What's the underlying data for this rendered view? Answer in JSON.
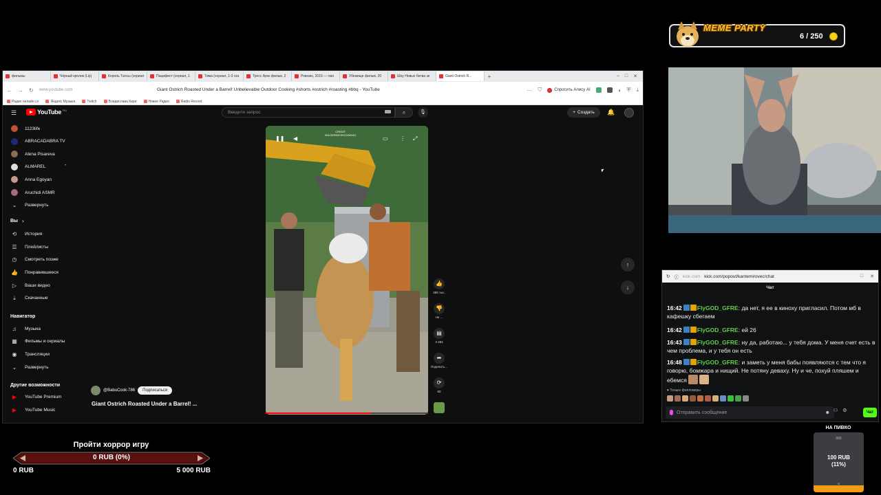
{
  "browser": {
    "tabs": [
      {
        "label": "фильмы"
      },
      {
        "label": "Чёрный кролик (Lip)"
      },
      {
        "label": "Король Талсы (сериал"
      },
      {
        "label": "Пацифист (сериал, 1"
      },
      {
        "label": "Тима (сериал, 1-3 сез"
      },
      {
        "label": "Тросс Архк фильм, 2"
      },
      {
        "label": "Ровнию, 2015 — смо"
      },
      {
        "label": "Убежище фильм, 20"
      },
      {
        "label": "Шоу Новых битва эк"
      },
      {
        "label": "Giant Ostrich R..."
      }
    ],
    "url_host": "www.youtube.com",
    "page_title": "Giant Ostrich Roasted Under a Barrel! Unbelievable Outdoor Cooking #shorts #ostrich #roasting #bbq - YouTube",
    "alice_label": "Спросить Алису AI",
    "bookmarks": [
      {
        "label": "Радио онлайн сл"
      },
      {
        "label": "Яндекс Музыка"
      },
      {
        "label": "Twitch"
      },
      {
        "label": "Владислава Кири"
      },
      {
        "label": "Новое Радио"
      },
      {
        "label": "Radio Record"
      }
    ]
  },
  "youtube": {
    "logo_text": "YouTube",
    "logo_region": "RU",
    "search_placeholder": "Введите запрос",
    "create_label": "Создать",
    "subscriptions": [
      {
        "label": "1123life",
        "color": "#b9563a"
      },
      {
        "label": "ABRACADABRA TV",
        "color": "#1c2b7a"
      },
      {
        "label": "Alena Pisareva",
        "color": "#8a6a58"
      },
      {
        "label": "ALMAREL",
        "color": "#ddd"
      },
      {
        "label": "Anna Egoyan",
        "color": "#c49a8a"
      },
      {
        "label": "Aruchidi ASMR",
        "color": "#a46b7b"
      }
    ],
    "expand_label": "Развернуть",
    "you_heading": "Вы",
    "you_items": [
      {
        "label": "История",
        "icon": "history-icon",
        "glyph": "⟲"
      },
      {
        "label": "Плейлисты",
        "icon": "playlist-icon",
        "glyph": "☰"
      },
      {
        "label": "Смотреть позже",
        "icon": "clock-icon",
        "glyph": "◷"
      },
      {
        "label": "Понравившиеся",
        "icon": "like-icon",
        "glyph": "👍"
      },
      {
        "label": "Ваши видео",
        "icon": "video-icon",
        "glyph": "▷"
      },
      {
        "label": "Скачанные",
        "icon": "download-icon",
        "glyph": "⤓"
      }
    ],
    "navigator_heading": "Навигатор",
    "navigator_items": [
      {
        "label": "Музыка",
        "icon": "music-icon",
        "glyph": "♫"
      },
      {
        "label": "Фильмы и сериалы",
        "icon": "film-icon",
        "glyph": "▦"
      },
      {
        "label": "Трансляции",
        "icon": "live-icon",
        "glyph": "◉"
      },
      {
        "label": "Развернуть",
        "icon": "chevron-down-icon",
        "glyph": "⌄"
      }
    ],
    "more_heading": "Другие возможности",
    "more_items": [
      {
        "label": "YouTube Premium",
        "icon": "premium-icon"
      },
      {
        "label": "YouTube Music",
        "icon": "yt-music-icon"
      }
    ],
    "short": {
      "credit": "CREDIT\nWILDERNESSCOOKING",
      "like_count": "386 тыс.",
      "dislike_label": "Не ...",
      "comment_count": "3 284",
      "share_label": "Поделить...",
      "remix_count": "60",
      "channel": "@BabuCook-786",
      "subscribe_label": "Подписаться",
      "title": "Giant Ostrich Roasted Under a Barrel! ...",
      "progress": 0.65
    }
  },
  "meme_party": {
    "title": "MEME PARTY",
    "count": "6 / 250"
  },
  "chat": {
    "url_host": "kick.com",
    "url_path": "kick.com/popout/kantemirovec/chat",
    "heading": "Чат",
    "messages": [
      {
        "time": "16:42",
        "user": "FlyGOD_GFRE",
        "text": "да нет, я ее в киноху пригласил. Потом мб в кафешку сбегаем"
      },
      {
        "time": "16:42",
        "user": "FlyGOD_GFRE",
        "text": "ей 26"
      },
      {
        "time": "16:43",
        "user": "FlyGOD_GFRE",
        "text": "ну да, работаю... у тебя дома. У меня счет есть в чем проблема, и у тебя он есть"
      },
      {
        "time": "16:48",
        "user": "FlyGOD_GFRE",
        "text": "и заметь у меня бабы появляются с тем что я говорю, бомжара и нищий. Не потяну деваху. Ну и че, похуй пляшем и ебемся"
      }
    ],
    "followers_only": "Только фолловеры",
    "input_placeholder": "Отправить сообщение",
    "send_label": "Чат"
  },
  "horror_goal": {
    "title": "Пройти хоррор игру",
    "label": "0 RUB (0%)",
    "min": "0 RUB",
    "max": "5 000 RUB",
    "progress": 0
  },
  "beer_goal": {
    "title": "НА ПИВКО",
    "top": "888",
    "amount": "100 RUB\n(11%)",
    "bottom": "0",
    "progress": 0.11
  }
}
